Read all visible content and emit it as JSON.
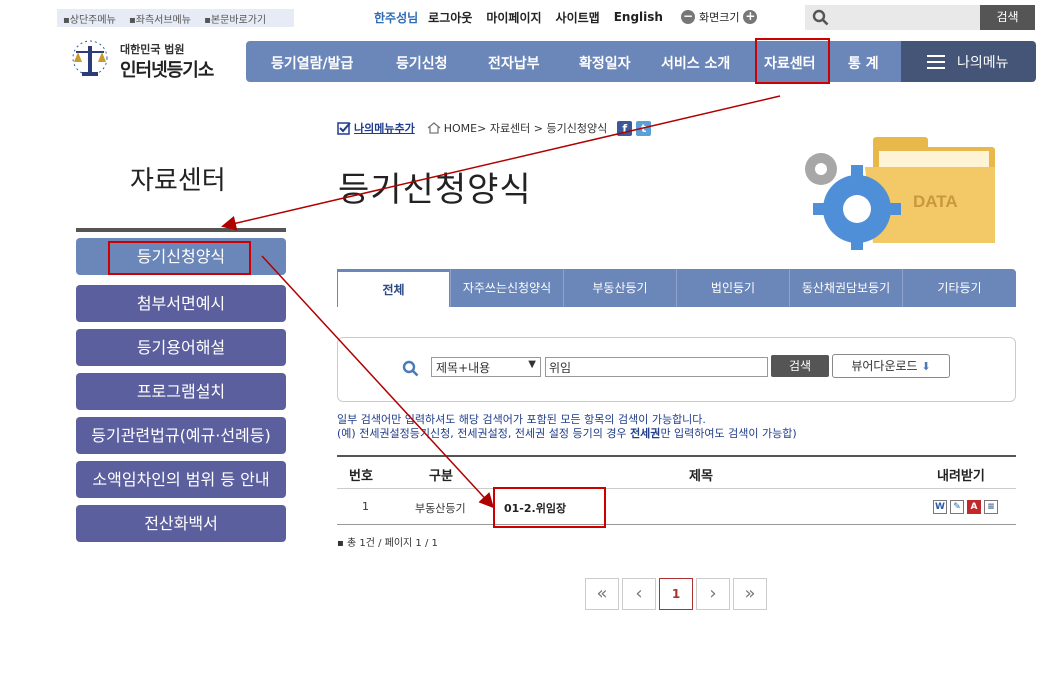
{
  "skip_links": [
    "상단주메뉴",
    "좌측서브메뉴",
    "본문바로가기"
  ],
  "util": {
    "user": "한주성님",
    "links": [
      "로그아웃",
      "마이페이지",
      "사이트맵",
      "English"
    ],
    "zoom_label": "화면크기",
    "search_button": "검색"
  },
  "logo": {
    "line1": "대한민국 법원",
    "line2": "인터넷등기소"
  },
  "gnb": [
    "등기열람/발급",
    "등기신청",
    "전자납부",
    "확정일자",
    "서비스 소개",
    "자료센터",
    "통 계"
  ],
  "my_menu": "나의메뉴",
  "breadcrumb": {
    "add_my_menu": "나의메뉴추가",
    "path": "HOME> 자료센터 > 등기신청양식"
  },
  "page_title": "등기신청양식",
  "left_title": "자료센터",
  "left_menu": [
    "등기신청양식",
    "첨부서면예시",
    "등기용어해설",
    "프로그램설치",
    "등기관련법규(예규·선례등)",
    "소액임차인의 범위 등 안내",
    "전산화백서"
  ],
  "tabs": [
    "전체",
    "자주쓰는신청양식",
    "부동산등기",
    "법인등기",
    "동산채권담보등기",
    "기타등기"
  ],
  "search": {
    "select_value": "제목+내용",
    "keyword": "위임",
    "search_button": "검색",
    "viewer_button": "뷰어다운로드"
  },
  "help": {
    "line1": "일부 검색어만 입력하셔도 해당 검색어가 포함된 모든 항목의 검색이 가능합니다.",
    "line2_a": "(예) 전세권설정등기신청, 전세권설정, 전세권 설정 등기의 경우 ",
    "line2_bold": "전세권",
    "line2_b": "만 입력하여도 검색이 가능합)"
  },
  "table": {
    "headers": [
      "번호",
      "구분",
      "제목",
      "내려받기"
    ],
    "rows": [
      {
        "no": "1",
        "category": "부동산등기",
        "title": "01-2.위임장"
      }
    ]
  },
  "total": "총 1건 / 페이지 1 / 1",
  "pagination": {
    "current": "1"
  },
  "colors": {
    "nav": "#6b86b8",
    "left_menu": "#5c5f9e",
    "highlight": "#c00000"
  }
}
